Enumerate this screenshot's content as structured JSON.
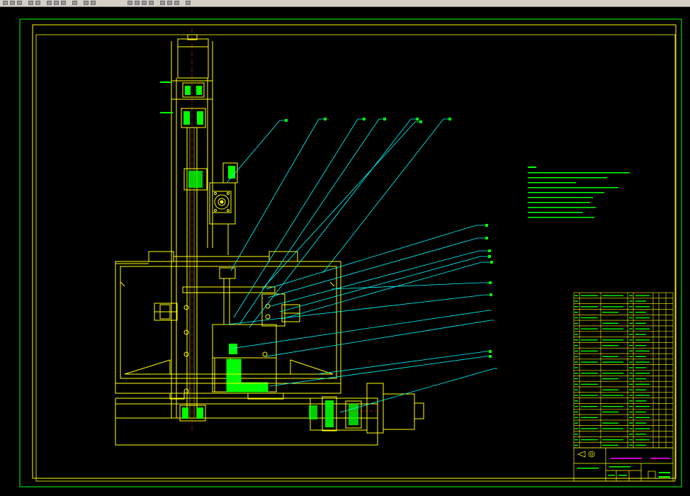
{
  "toolbar": {
    "icons": [
      "new-icon",
      "open-icon",
      "save-icon",
      "print-icon",
      "preview-icon",
      "cut-icon",
      "copy-icon",
      "paste-icon",
      "match-icon",
      "undo-icon",
      "redo-icon",
      "pan-icon",
      "zoom-icon",
      "zoom-window-icon",
      "zoom-prev-icon",
      "properties-icon",
      "design-center-icon",
      "tool-palette-icon",
      "help-icon"
    ]
  },
  "colors": {
    "background": "#000000",
    "frame": "#00ff00",
    "border": "#ffff00",
    "geometry": "#ffff00",
    "leader": "#00ffff",
    "fill": "#00ff00",
    "title_text": "#ff00ff"
  },
  "drawing": {
    "left_labels": [
      "",
      ""
    ],
    "notes": {
      "heading": "",
      "lines": [
        "",
        "",
        "",
        "",
        "",
        "",
        "",
        "",
        "",
        ""
      ]
    },
    "balloons_top_count": 5,
    "balloons_right_count": 12
  },
  "title_block": {
    "drawing_name": "",
    "drawing_number": "",
    "company": "",
    "parts_rows": 28
  }
}
